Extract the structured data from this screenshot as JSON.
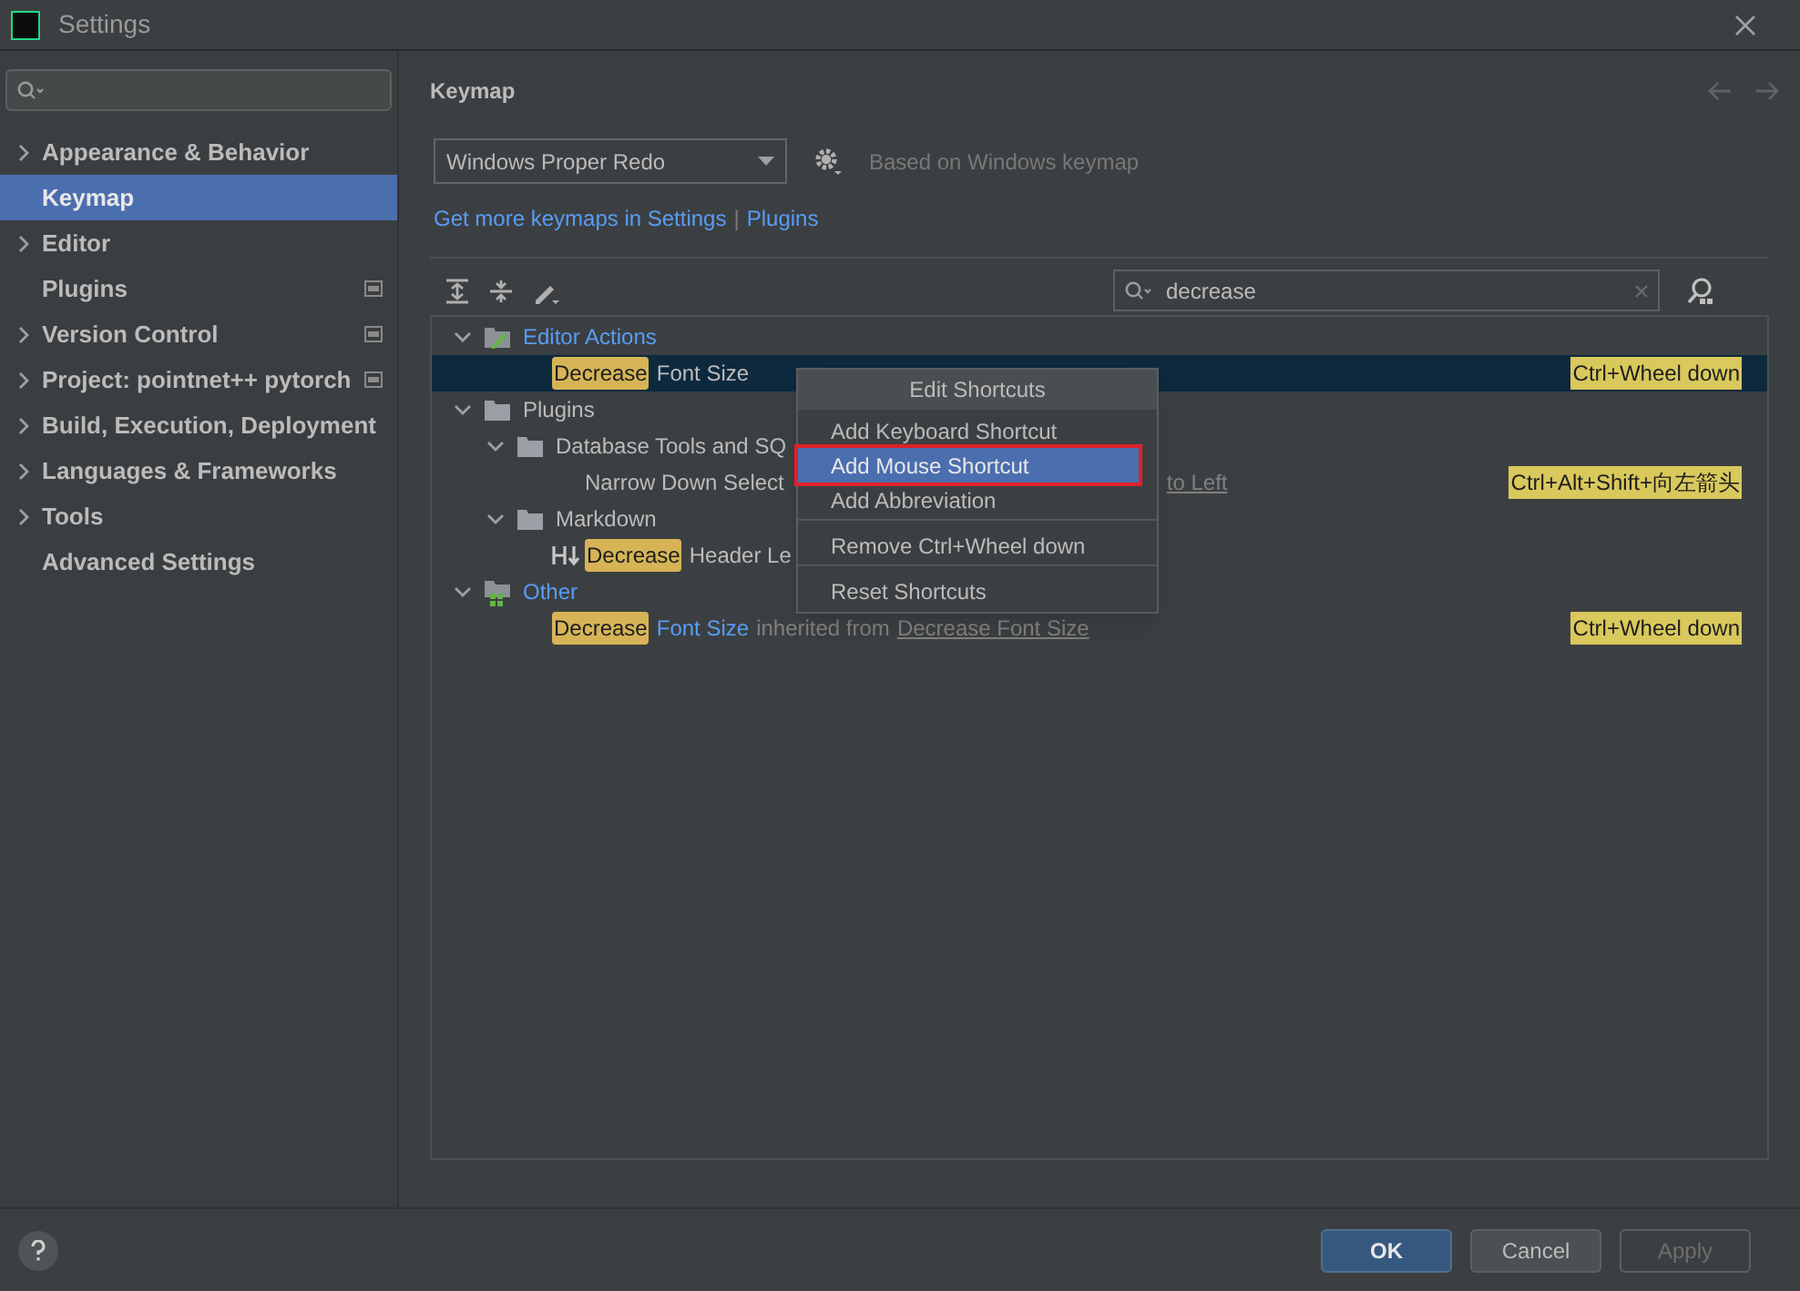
{
  "window": {
    "title": "Settings"
  },
  "sidebar": {
    "items": [
      {
        "label": "Appearance & Behavior",
        "expandable": true,
        "selected": false,
        "marker": false
      },
      {
        "label": "Keymap",
        "expandable": false,
        "selected": true,
        "marker": false
      },
      {
        "label": "Editor",
        "expandable": true,
        "selected": false,
        "marker": false
      },
      {
        "label": "Plugins",
        "expandable": false,
        "selected": false,
        "marker": true
      },
      {
        "label": "Version Control",
        "expandable": true,
        "selected": false,
        "marker": true
      },
      {
        "label": "Project: pointnet++ pytorch",
        "expandable": true,
        "selected": false,
        "marker": true
      },
      {
        "label": "Build, Execution, Deployment",
        "expandable": true,
        "selected": false,
        "marker": false
      },
      {
        "label": "Languages & Frameworks",
        "expandable": true,
        "selected": false,
        "marker": false
      },
      {
        "label": "Tools",
        "expandable": true,
        "selected": false,
        "marker": false
      },
      {
        "label": "Advanced Settings",
        "expandable": false,
        "selected": false,
        "marker": false
      }
    ]
  },
  "page": {
    "title": "Keymap",
    "keymap_select": {
      "value": "Windows Proper Redo"
    },
    "based_on": "Based on Windows keymap",
    "links": [
      "Get more keymaps in Settings",
      "Plugins"
    ],
    "link_separator": "|"
  },
  "filter": {
    "value": "decrease"
  },
  "tree": [
    {
      "kind": "category",
      "label": "Editor Actions",
      "expanded": true,
      "children": [
        {
          "kind": "action",
          "selected": true,
          "parts": [
            {
              "text": "Decrease",
              "kind": "match"
            },
            {
              "text": "Font Size",
              "kind": "plain"
            }
          ],
          "shortcut": "Ctrl+Wheel down"
        }
      ]
    },
    {
      "kind": "folder",
      "label": "Plugins",
      "expanded": true,
      "children": [
        {
          "kind": "folder",
          "label": "Database Tools and SQ",
          "expanded": true,
          "children": [
            {
              "kind": "action",
              "selected": false,
              "parts": [
                {
                  "text": "Narrow Down Select",
                  "kind": "plain"
                },
                {
                  "text": "to Left",
                  "kind": "underlined",
                  "gap": true
                }
              ],
              "shortcut": "Ctrl+Alt+Shift+向左箭头"
            }
          ]
        },
        {
          "kind": "folder",
          "label": "Markdown",
          "expanded": true,
          "children": [
            {
              "kind": "heading-action",
              "selected": false,
              "parts": [
                {
                  "text": "Decrease",
                  "kind": "match"
                },
                {
                  "text": "Header Le",
                  "kind": "plain"
                }
              ]
            }
          ]
        }
      ]
    },
    {
      "kind": "other",
      "label": "Other",
      "expanded": true,
      "children": [
        {
          "kind": "action",
          "selected": false,
          "parts": [
            {
              "text": "Decrease",
              "kind": "match"
            },
            {
              "text": "Font Size",
              "kind": "link"
            },
            {
              "text": "inherited from",
              "kind": "muted"
            },
            {
              "text": "Decrease Font Size",
              "kind": "underlined"
            }
          ],
          "shortcut": "Ctrl+Wheel down"
        }
      ]
    }
  ],
  "context_menu": {
    "title": "Edit Shortcuts",
    "items": [
      {
        "label": "Add Keyboard Shortcut",
        "selected": false,
        "annotated": false,
        "separator_before": false
      },
      {
        "label": "Add Mouse Shortcut",
        "selected": true,
        "annotated": true,
        "separator_before": false
      },
      {
        "label": "Add Abbreviation",
        "selected": false,
        "annotated": false,
        "separator_before": false
      },
      {
        "label": "Remove Ctrl+Wheel down",
        "selected": false,
        "annotated": false,
        "separator_before": true
      },
      {
        "label": "Reset Shortcuts",
        "selected": false,
        "annotated": false,
        "separator_before": true
      }
    ]
  },
  "buttons": [
    {
      "label": "OK",
      "kind": "primary"
    },
    {
      "label": "Cancel",
      "kind": "normal"
    },
    {
      "label": "Apply",
      "kind": "disabled"
    }
  ]
}
